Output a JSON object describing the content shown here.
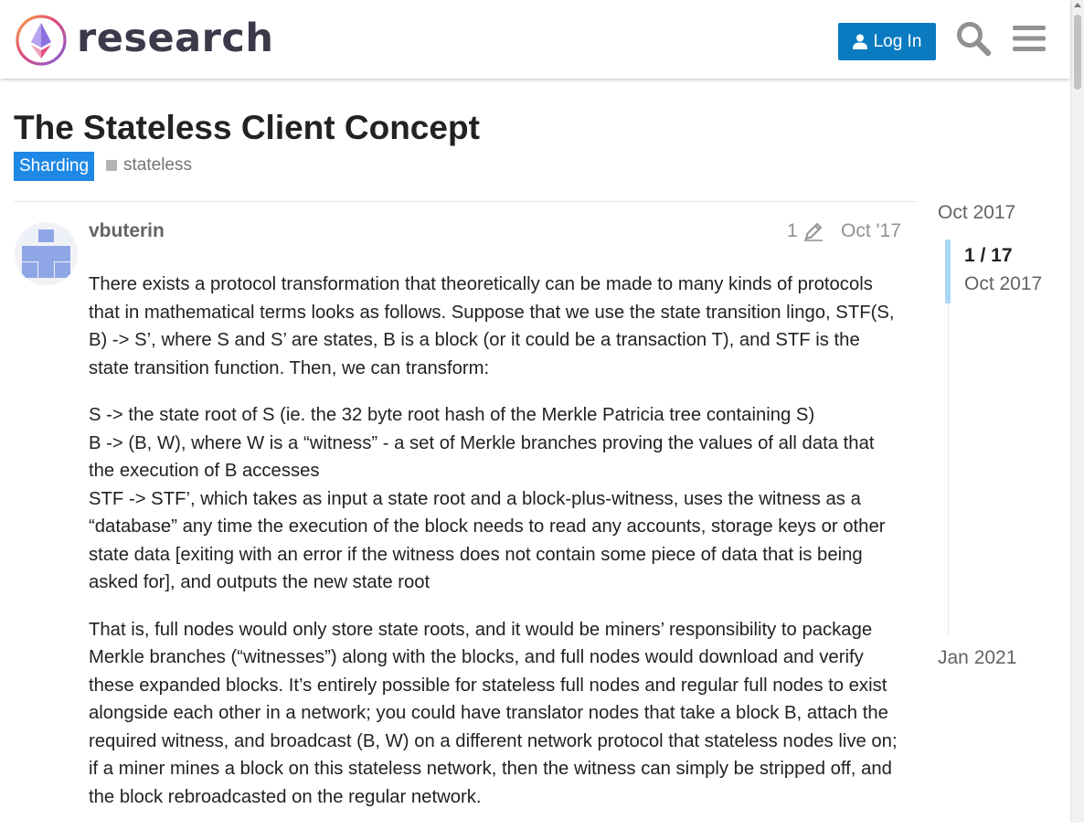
{
  "header": {
    "logo_text": "research",
    "login_label": "Log In",
    "search_icon": "search-icon",
    "menu_icon": "hamburger-menu-icon",
    "accent_color": "#0a7bc1"
  },
  "topic": {
    "title": "The Stateless Client Concept",
    "category": "Sharding",
    "category_color": "#1e88e5",
    "tag": "stateless"
  },
  "post": {
    "username": "vbuterin",
    "edit_count": "1",
    "edit_icon": "pencil-icon",
    "date": "Oct '17",
    "paragraphs": [
      "There exists a protocol transformation that theoretically can be made to many kinds of protocols that in mathematical terms looks as follows. Suppose that we use the state transition lingo, STF(S, B) -> S’, where S and S’ are states, B is a block (or it could be a transaction T), and STF is the state transition function. Then, we can transform:",
      "S -> the state root of S (ie. the 32 byte root hash of the Merkle Patricia tree containing S)",
      "B -> (B, W), where W is a “witness” - a set of Merkle branches proving the values of all data that the execution of B accesses",
      "STF -> STF’, which takes as input a state root and a block-plus-witness, uses the witness as a “database” any time the execution of the block needs to read any accounts, storage keys or other state data [exiting with an error if the witness does not contain some piece of data that is being asked for], and outputs the new state root",
      "That is, full nodes would only store state roots, and it would be miners’ responsibility to package Merkle branches (“witnesses”) along with the blocks, and full nodes would download and verify these expanded blocks. It’s entirely possible for stateless full nodes and regular full nodes to exist alongside each other in a network; you could have translator nodes that take a block B, attach the required witness, and broadcast (B, W) on a different network protocol that stateless nodes live on; if a miner mines a block on this stateless network, then the witness can simply be stripped off, and the block rebroadcasted on the regular network."
    ]
  },
  "timeline": {
    "start_date": "Oct 2017",
    "position": "1 / 17",
    "position_date": "Oct 2017",
    "end_date": "Jan 2021",
    "progress_fraction": 0.0
  }
}
